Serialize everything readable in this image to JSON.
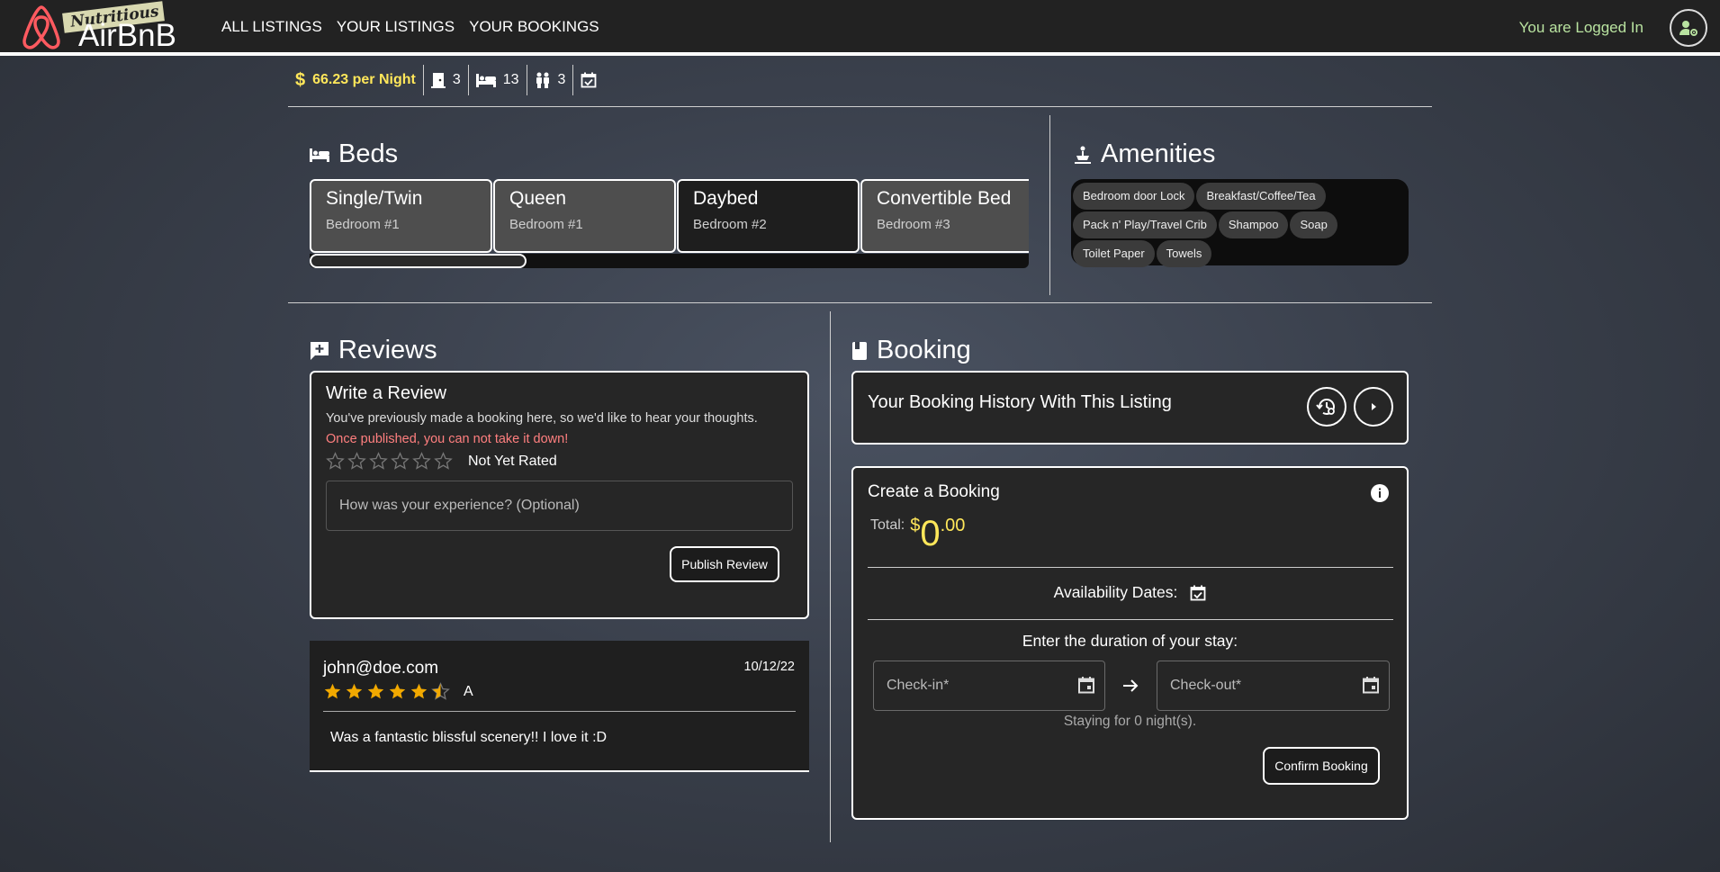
{
  "header": {
    "logo_tag": "Nutritious",
    "logo_brand": "AirBnB",
    "nav": [
      "ALL LISTINGS",
      "YOUR LISTINGS",
      "YOUR BOOKINGS"
    ],
    "status": "You are Logged In"
  },
  "info": {
    "price": "66.23 per Night",
    "bedrooms": "3",
    "beds": "13",
    "guests": "3"
  },
  "beds": {
    "title": "Beds",
    "items": [
      {
        "type": "Single/Twin",
        "room": "Bedroom #1"
      },
      {
        "type": "Queen",
        "room": "Bedroom #1"
      },
      {
        "type": "Daybed",
        "room": "Bedroom #2"
      },
      {
        "type": "Convertible Bed",
        "room": "Bedroom #3"
      }
    ]
  },
  "amenities": {
    "title": "Amenities",
    "items": [
      "Bedroom door Lock",
      "Breakfast/Coffee/Tea",
      "Pack n' Play/Travel Crib",
      "Shampoo",
      "Soap",
      "Toilet Paper",
      "Towels"
    ]
  },
  "reviews": {
    "title": "Reviews",
    "write": {
      "heading": "Write a Review",
      "note": "You've previously made a booking here, so we'd like to hear your thoughts.",
      "warning": "Once published, you can not take it down!",
      "rating_text": "Not Yet Rated",
      "placeholder": "How was your experience? (Optional)",
      "publish": "Publish Review"
    },
    "list": [
      {
        "author": "john@doe.com",
        "date": "10/12/22",
        "rating": 4.5,
        "grade": "A",
        "text": "Was a fantastic blissful scenery!! I love it :D"
      }
    ]
  },
  "booking": {
    "title": "Booking",
    "history_label": "Your Booking History With This Listing",
    "create_heading": "Create a Booking",
    "total_label": "Total:",
    "currency": "$",
    "total_int": "0",
    "total_dec": ".00",
    "availability_label": "Availability Dates:",
    "duration_label": "Enter the duration of your stay:",
    "checkin_placeholder": "Check-in*",
    "checkout_placeholder": "Check-out*",
    "staying_text": "Staying for 0 night(s).",
    "confirm": "Confirm Booking"
  },
  "colors": {
    "accent_yellow": "#ffe75a",
    "warning_red": "#ff7f7f",
    "star_gold": "#f2a900",
    "logged_green": "#b9e3a0"
  }
}
